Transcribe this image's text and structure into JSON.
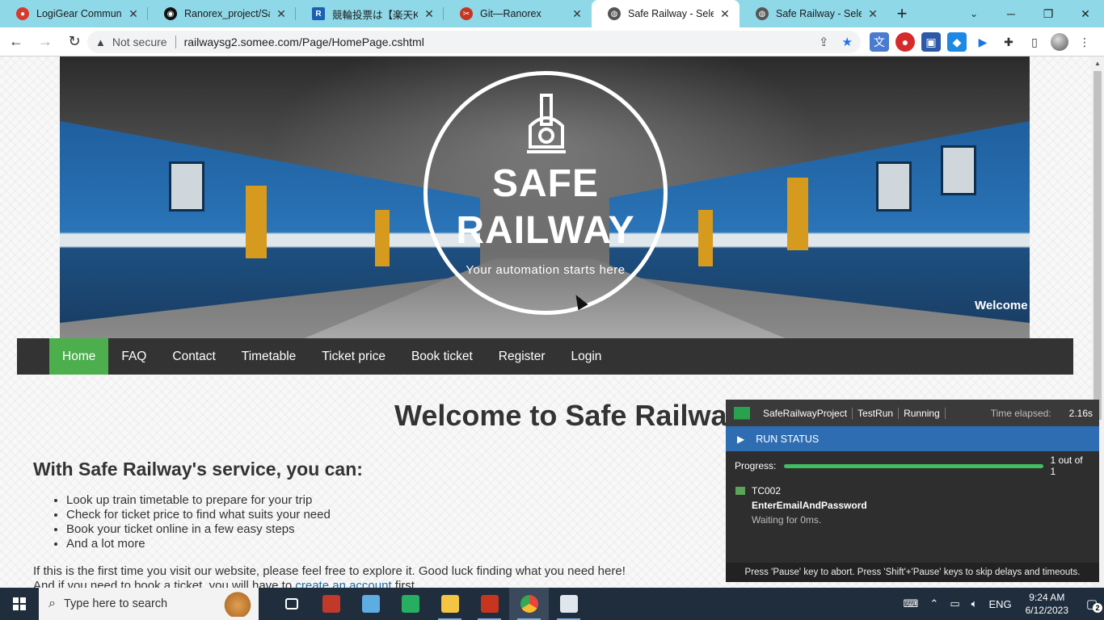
{
  "browser": {
    "tabs": [
      {
        "title": "LogiGear Communicat",
        "favicon": "chat-icon",
        "color": "#d9382c"
      },
      {
        "title": "Ranorex_project/SafeR",
        "favicon": "github-icon",
        "color": "#111111"
      },
      {
        "title": "競輪投票は【楽天Kドリー",
        "favicon": "r-logo-icon",
        "color": "#1a5fb4"
      },
      {
        "title": "Git—Ranorex",
        "favicon": "ranorex-icon",
        "color": "#c7351f"
      },
      {
        "title": "Safe Railway - Seleniu",
        "favicon": "globe-icon",
        "color": "#555555",
        "active": true
      },
      {
        "title": "Safe Railway - Seleniu",
        "favicon": "globe-icon",
        "color": "#555555"
      }
    ],
    "new_tab": "+",
    "security": "Not secure",
    "url": "railwaysg2.somee.com/Page/HomePage.cshtml",
    "window_controls": [
      "─",
      "❐",
      "✕"
    ]
  },
  "site": {
    "logo_title_1": "SAFE",
    "logo_title_2": "RAILWAY",
    "tagline": "Your automation starts here",
    "welcome_user": "Welcome guest!",
    "nav": [
      "Home",
      "FAQ",
      "Contact",
      "Timetable",
      "Ticket price",
      "Book ticket",
      "Register",
      "Login"
    ],
    "active_nav": "Home",
    "heading": "Welcome to Safe Railway",
    "service_heading": "With Safe Railway's service, you can:",
    "features": [
      "Look up train timetable to prepare for your trip",
      "Check for ticket price to find what suits your need",
      "Book your ticket online in a few easy steps",
      "And a lot more"
    ],
    "intro_line1": "If this is the first time you visit our website, please feel free to explore it. Good luck finding what you need here!",
    "intro_line2_pre": "And if you need to book a ticket, you will have to ",
    "intro_link": "create an account",
    "intro_line2_post": " first.",
    "accent_color": "#4cae4c",
    "nav_color": "#333333"
  },
  "run_panel": {
    "project": "SafeRailwayProject",
    "test_run": "TestRun",
    "state": "Running",
    "time_elapsed_label": "Time elapsed:",
    "time_elapsed": "2.16s",
    "status_title": "RUN STATUS",
    "progress_label": "Progress:",
    "progress_text": "1 out of 1",
    "progress_fraction": 1.0,
    "test_case": "TC002",
    "module": "EnterEmailAndPassword",
    "wait_text": "Waiting for 0ms.",
    "footer": "Press 'Pause' key to abort. Press 'Shift'+'Pause' keys to skip delays and timeouts."
  },
  "taskbar": {
    "search_placeholder": "Type here to search",
    "language": "ENG",
    "time": "9:24 AM",
    "date": "6/12/2023",
    "notifications": "2",
    "apps": [
      {
        "name": "task-view-icon",
        "color": "#ffffff"
      },
      {
        "name": "app-icon-1",
        "color": "#c0392b"
      },
      {
        "name": "app-icon-2",
        "color": "#5dade2"
      },
      {
        "name": "app-icon-3",
        "color": "#27ae60"
      },
      {
        "name": "file-explorer-icon",
        "color": "#f4c542"
      },
      {
        "name": "ranorex-icon",
        "color": "#c7351f"
      },
      {
        "name": "chrome-icon",
        "color": "#e8453c"
      },
      {
        "name": "app-icon-4",
        "color": "#dfe6ec"
      }
    ]
  }
}
